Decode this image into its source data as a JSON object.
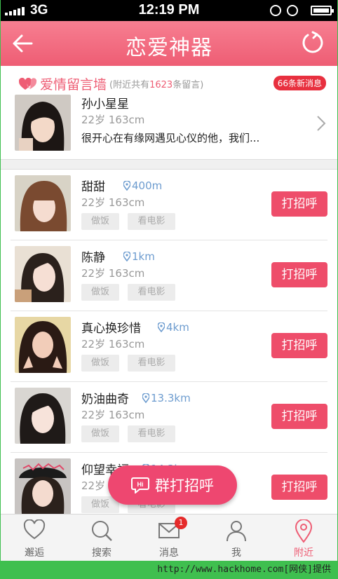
{
  "status_bar": {
    "carrier": "3G",
    "time": "12:19 PM"
  },
  "header": {
    "title": "恋爱神器"
  },
  "wall": {
    "title": "爱情留言墙",
    "note_prefix": "(附近共有",
    "note_count": "1623",
    "note_suffix": "条留言)",
    "new_badge": "66条新消息",
    "user": {
      "name": "孙小星星",
      "meta": "22岁  163cm",
      "message": "很开心在有缘网遇见心仪的他，我们..."
    }
  },
  "people": [
    {
      "name": "甜甜",
      "distance": "400m",
      "meta": "22岁  163cm",
      "tags": [
        "做饭",
        "看电影"
      ],
      "greet": "打招呼"
    },
    {
      "name": "陈静",
      "distance": "1km",
      "meta": "22岁  163cm",
      "tags": [
        "做饭",
        "看电影"
      ],
      "greet": "打招呼"
    },
    {
      "name": "真心换珍惜",
      "distance": "4km",
      "meta": "22岁  163cm",
      "tags": [
        "做饭",
        "看电影"
      ],
      "greet": "打招呼"
    },
    {
      "name": "奶油曲奇",
      "distance": "13.3km",
      "meta": "22岁  163cm",
      "tags": [
        "做饭",
        "看电影"
      ],
      "greet": "打招呼"
    },
    {
      "name": "仰望幸福",
      "distance": "14.3km",
      "meta": "22岁  163cm",
      "tags": [
        "做饭",
        "看电影"
      ],
      "greet": "打招呼"
    }
  ],
  "group_greet": {
    "label": "群打招呼",
    "icon_text": "Hi"
  },
  "tabs": [
    {
      "label": "邂逅",
      "icon": "heart-icon"
    },
    {
      "label": "搜索",
      "icon": "search-icon"
    },
    {
      "label": "消息",
      "icon": "mail-icon",
      "badge": "1"
    },
    {
      "label": "我",
      "icon": "person-icon"
    },
    {
      "label": "附近",
      "icon": "location-icon",
      "active": true
    }
  ],
  "colors": {
    "accent": "#ee5d74",
    "button": "#ee4d6a",
    "distance": "#6d9ccf"
  },
  "watermark": "http://www.hackhome.com[网侠]提供"
}
